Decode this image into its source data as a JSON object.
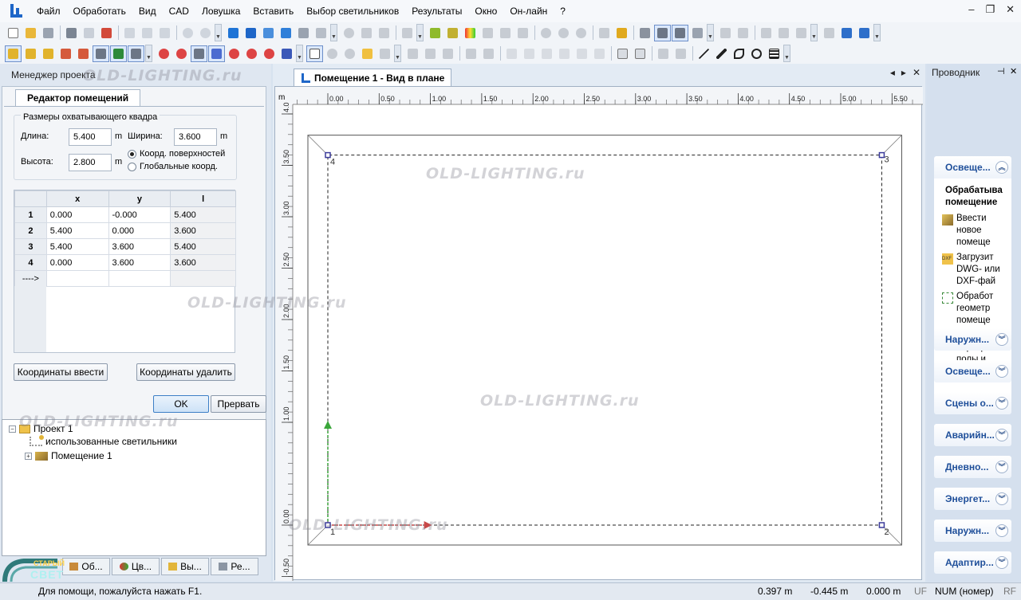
{
  "menu": [
    "Файл",
    "Обработать",
    "Вид",
    "CAD",
    "Ловушка",
    "Вставить",
    "Выбор светильников",
    "Результаты",
    "Окно",
    "Он-лайн",
    "?"
  ],
  "window_controls": {
    "minimize": "–",
    "restore": "❐",
    "close": "✕"
  },
  "watermark": "OLD-LIGHTING.ru",
  "project_manager": {
    "title": "Менеджер проекта"
  },
  "room_editor": {
    "tab_label": "Редактор помещений",
    "group_legend": "Размеры охватывающего квадра",
    "length_label": "Длина:",
    "length_value": "5.400",
    "width_label": "Ширина:",
    "width_value": "3.600",
    "height_label": "Высота:",
    "height_value": "2.800",
    "unit": "m",
    "radio_surface": "Коорд. поверхностей",
    "radio_global": "Глобальные коорд.",
    "table": {
      "headers": [
        "x",
        "y",
        "l"
      ],
      "rows": [
        {
          "n": "1",
          "x": "0.000",
          "y": "-0.000",
          "l": "5.400"
        },
        {
          "n": "2",
          "x": "5.400",
          "y": "0.000",
          "l": "3.600"
        },
        {
          "n": "3",
          "x": "5.400",
          "y": "3.600",
          "l": "5.400"
        },
        {
          "n": "4",
          "x": "0.000",
          "y": "3.600",
          "l": "3.600"
        }
      ],
      "new_row_marker": "---->"
    },
    "btn_add_coords": "Координаты ввести",
    "btn_del_coords": "Координаты удалить",
    "btn_ok": "OK",
    "btn_cancel": "Прервать"
  },
  "tree": {
    "project": "Проект 1",
    "used_luminaires": "использованные светильники",
    "room": "Помещение 1"
  },
  "bottom_tabs": [
    "Об...",
    "Цв...",
    "Вы...",
    "Ре..."
  ],
  "logo_text": {
    "top": "СТАРЫЙ",
    "bottom": "СВЕТ"
  },
  "document": {
    "tab_title": "Помещение 1 - Вид в плане",
    "unit_label": "m",
    "x_ticks": [
      "0.00",
      "0.50",
      "1.00",
      "1.50",
      "2.00",
      "2.50",
      "3.00",
      "3.50",
      "4.00",
      "4.50",
      "5.00",
      "5.50"
    ],
    "y_ticks": [
      "4.0",
      "3.50",
      "3.00",
      "2.50",
      "2.00",
      "1.50",
      "1.00",
      "0.00",
      "-0.50"
    ],
    "corner_labels": [
      "1",
      "2",
      "3",
      "4"
    ]
  },
  "explorer": {
    "title": "Проводник",
    "section_open": "Освеще...",
    "body_title": "Обрабатыва помещение",
    "items": [
      {
        "icon": "room-box-icon",
        "text": "Ввести новое помеще"
      },
      {
        "icon": "dxf-folder-icon",
        "text": "Загрузит DWG- или DXF-фай"
      },
      {
        "icon": "geometry-icon",
        "text": "Обработ геометр помеще"
      },
      {
        "icon": "ceiling-icon",
        "text": "Ввести перекры полы и"
      }
    ],
    "sections": [
      "Наружн...",
      "Освеще...",
      "Сцены о...",
      "Аварийн...",
      "Дневно...",
      "Энергет...",
      "Наружн...",
      "Адаптир..."
    ]
  },
  "status": {
    "hint": "Для помощи, пожалуйста нажать F1.",
    "x": "0.397 m",
    "y": "-0.445 m",
    "z": "0.000 m",
    "uf": "UF",
    "num": "NUM (номер)",
    "rf": "RF"
  },
  "colors": {
    "accent": "#1e66c8",
    "explorer_text": "#1f4f9a",
    "green_axis": "#3aa63a",
    "red_axis": "#c84848",
    "corner": "#3a3a9a"
  }
}
